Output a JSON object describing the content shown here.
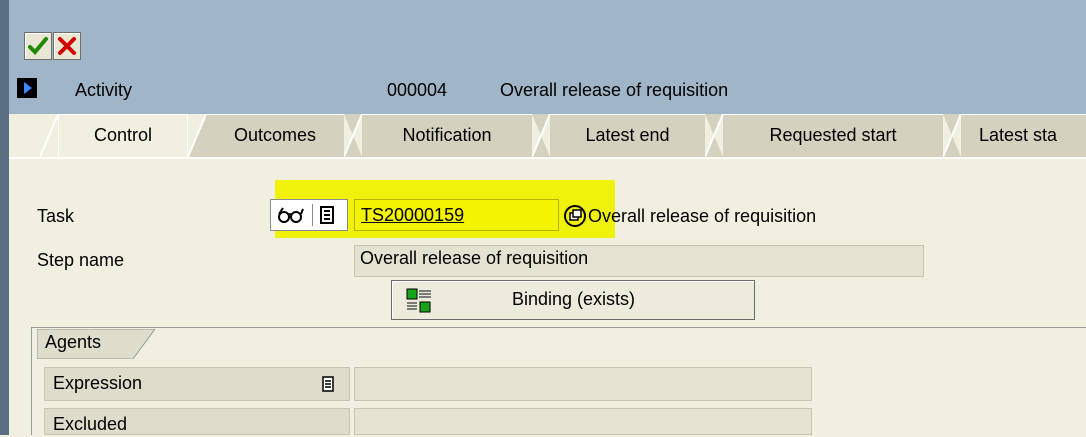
{
  "toolbar": {
    "confirm_icon": "green-check-icon",
    "cancel_icon": "red-x-icon"
  },
  "header": {
    "activity_label": "Activity",
    "activity_number": "000004",
    "activity_name": "Overall release of requisition"
  },
  "tabs": [
    {
      "label": "Control",
      "active": true
    },
    {
      "label": "Outcomes",
      "active": false
    },
    {
      "label": "Notification",
      "active": false
    },
    {
      "label": "Latest end",
      "active": false
    },
    {
      "label": "Requested start",
      "active": false
    },
    {
      "label": "Latest sta",
      "active": false
    }
  ],
  "control": {
    "task_label": "Task",
    "task_value": "TS20000159",
    "task_description": "Overall release of requisition",
    "step_name_label": "Step name",
    "step_name_value": "Overall release of requisition",
    "binding_button": "Binding (exists)"
  },
  "agents": {
    "group_title": "Agents",
    "expression_label": "Expression",
    "excluded_label": "Excluded"
  },
  "colors": {
    "header_bg": "#a0b5c7",
    "content_bg": "#f0efe0",
    "highlight": "#f1f20b"
  }
}
